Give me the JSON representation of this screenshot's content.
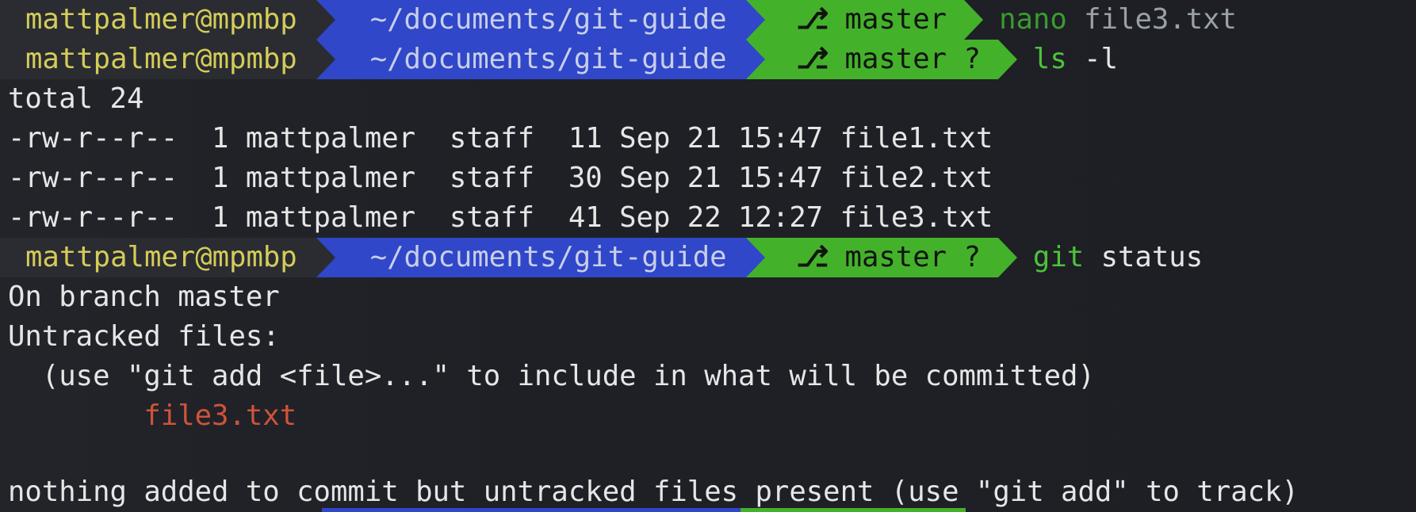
{
  "theme": {
    "background": "#1f2128",
    "user_fg": "#d4cc58",
    "dir_bg": "#2f47c8",
    "branch_bg": "#44b12b",
    "command_fg": "#4cc23a",
    "untracked_fg": "#d0533a"
  },
  "prompt": {
    "user_host": "mattpalmer@mpmbp",
    "directory": "~/documents/git-guide",
    "branch_icon": "git-branch-icon",
    "branch": "master",
    "branch_dirty": "master ?"
  },
  "commands": [
    {
      "name": "nano",
      "args": " file3.txt"
    },
    {
      "name": "ls",
      "args": " -l"
    },
    {
      "name": "git",
      "args": " status"
    }
  ],
  "ls_output": {
    "total": "total 24",
    "rows": [
      "-rw-r--r--  1 mattpalmer  staff  11 Sep 21 15:47 file1.txt",
      "-rw-r--r--  1 mattpalmer  staff  30 Sep 21 15:47 file2.txt",
      "-rw-r--r--  1 mattpalmer  staff  41 Sep 22 12:27 file3.txt"
    ]
  },
  "git_status_output": {
    "on_branch": "On branch master",
    "untracked_header": "Untracked files:",
    "hint": "  (use \"git add <file>...\" to include in what will be committed)",
    "untracked_file": "        file3.txt",
    "summary": "nothing added to commit but untracked files present (use \"git add\" to track)"
  }
}
